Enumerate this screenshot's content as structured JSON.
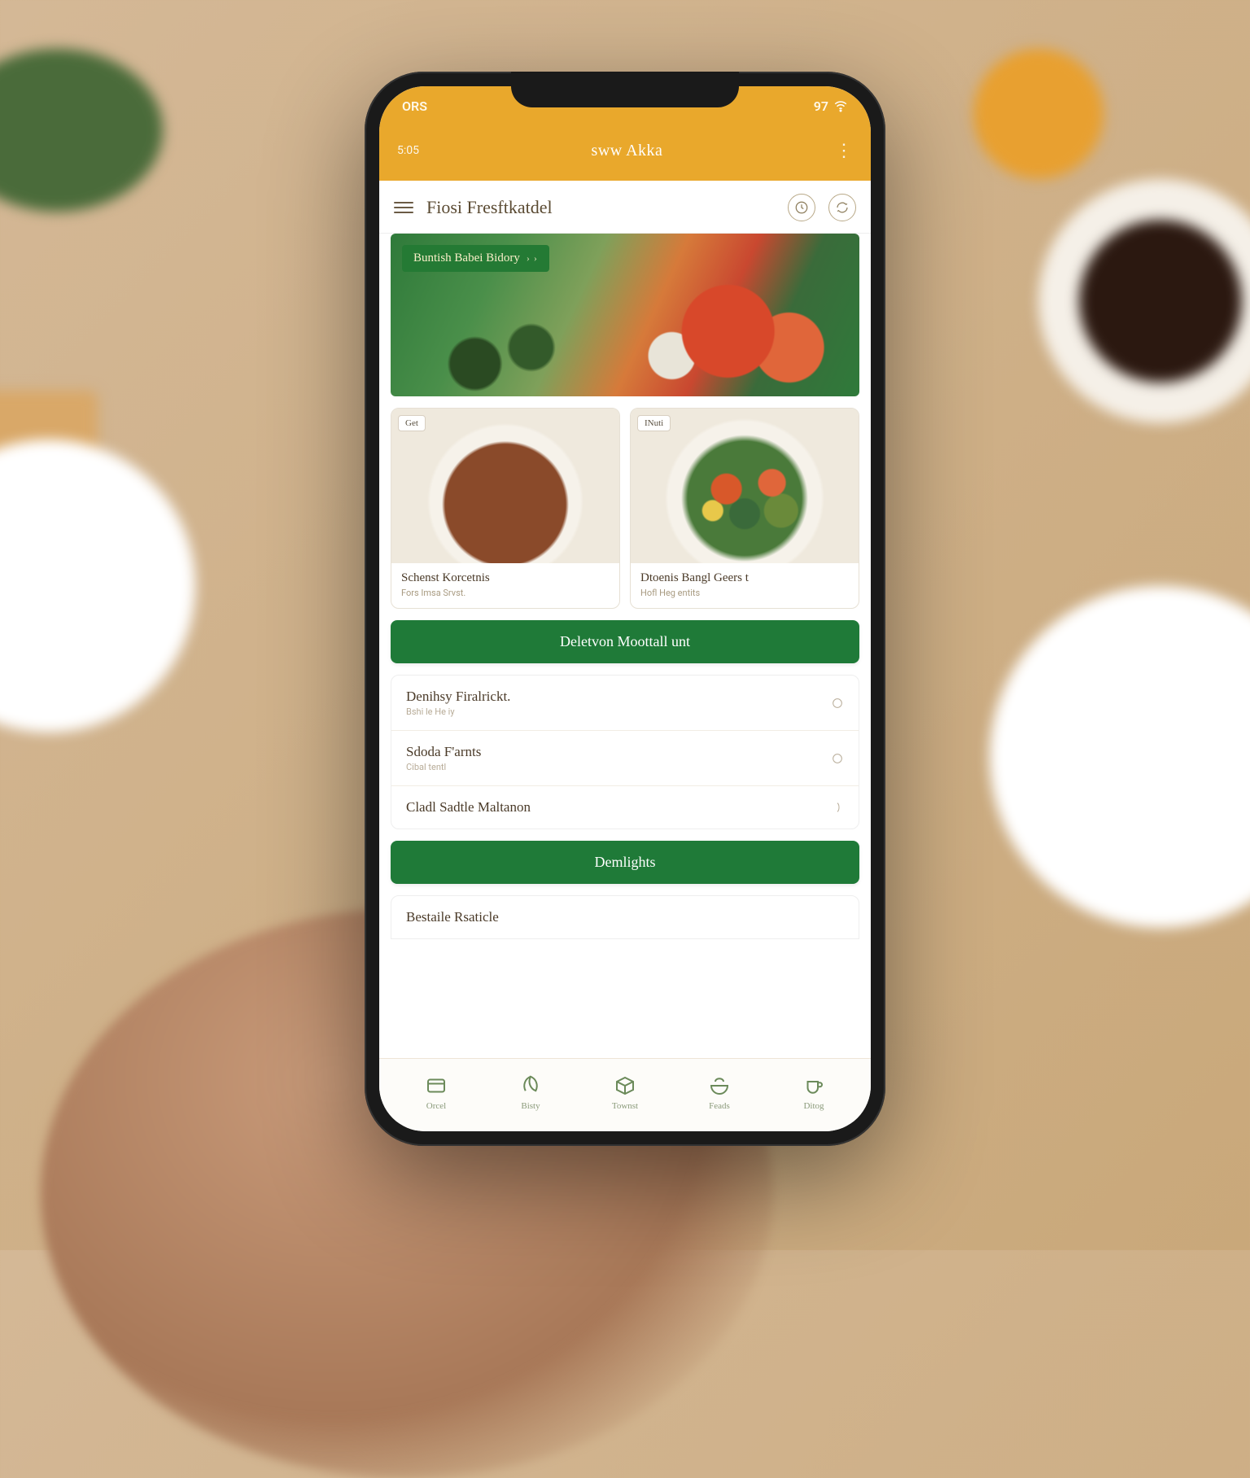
{
  "status": {
    "left": "ORS",
    "left2": "5:05",
    "right": "97"
  },
  "appbar": {
    "burger_time": "=",
    "title": "sww Akka"
  },
  "section": {
    "title": "Fiosi Fresftkatdel"
  },
  "banner": {
    "chip": "Buntish Babei Bidory",
    "chip_arrows": "› ›"
  },
  "cards": [
    {
      "chip": "Get",
      "name": "Schenst Korcetnis",
      "sub": "Fors Imsa Srvst."
    },
    {
      "chip": "INuti",
      "name": "Dtoenis Bangl Geers t",
      "sub": "Hofl Heg entits"
    }
  ],
  "cta1": "Deletvon Moottall unt",
  "list": [
    {
      "name": "Denihsy Firalrickt.",
      "sub": "Bshi le He iy"
    },
    {
      "name": "Sdoda F'arnts",
      "sub": "Cibal tentl"
    },
    {
      "name": "Cladl Sadtle Maltanon",
      "sub": ""
    }
  ],
  "cta2": "Demlights",
  "peek": "Bestaile Rsaticle",
  "nav": [
    {
      "label": "Orcel"
    },
    {
      "label": "Bisty"
    },
    {
      "label": "Townst"
    },
    {
      "label": "Feads"
    },
    {
      "label": "Ditog"
    }
  ]
}
